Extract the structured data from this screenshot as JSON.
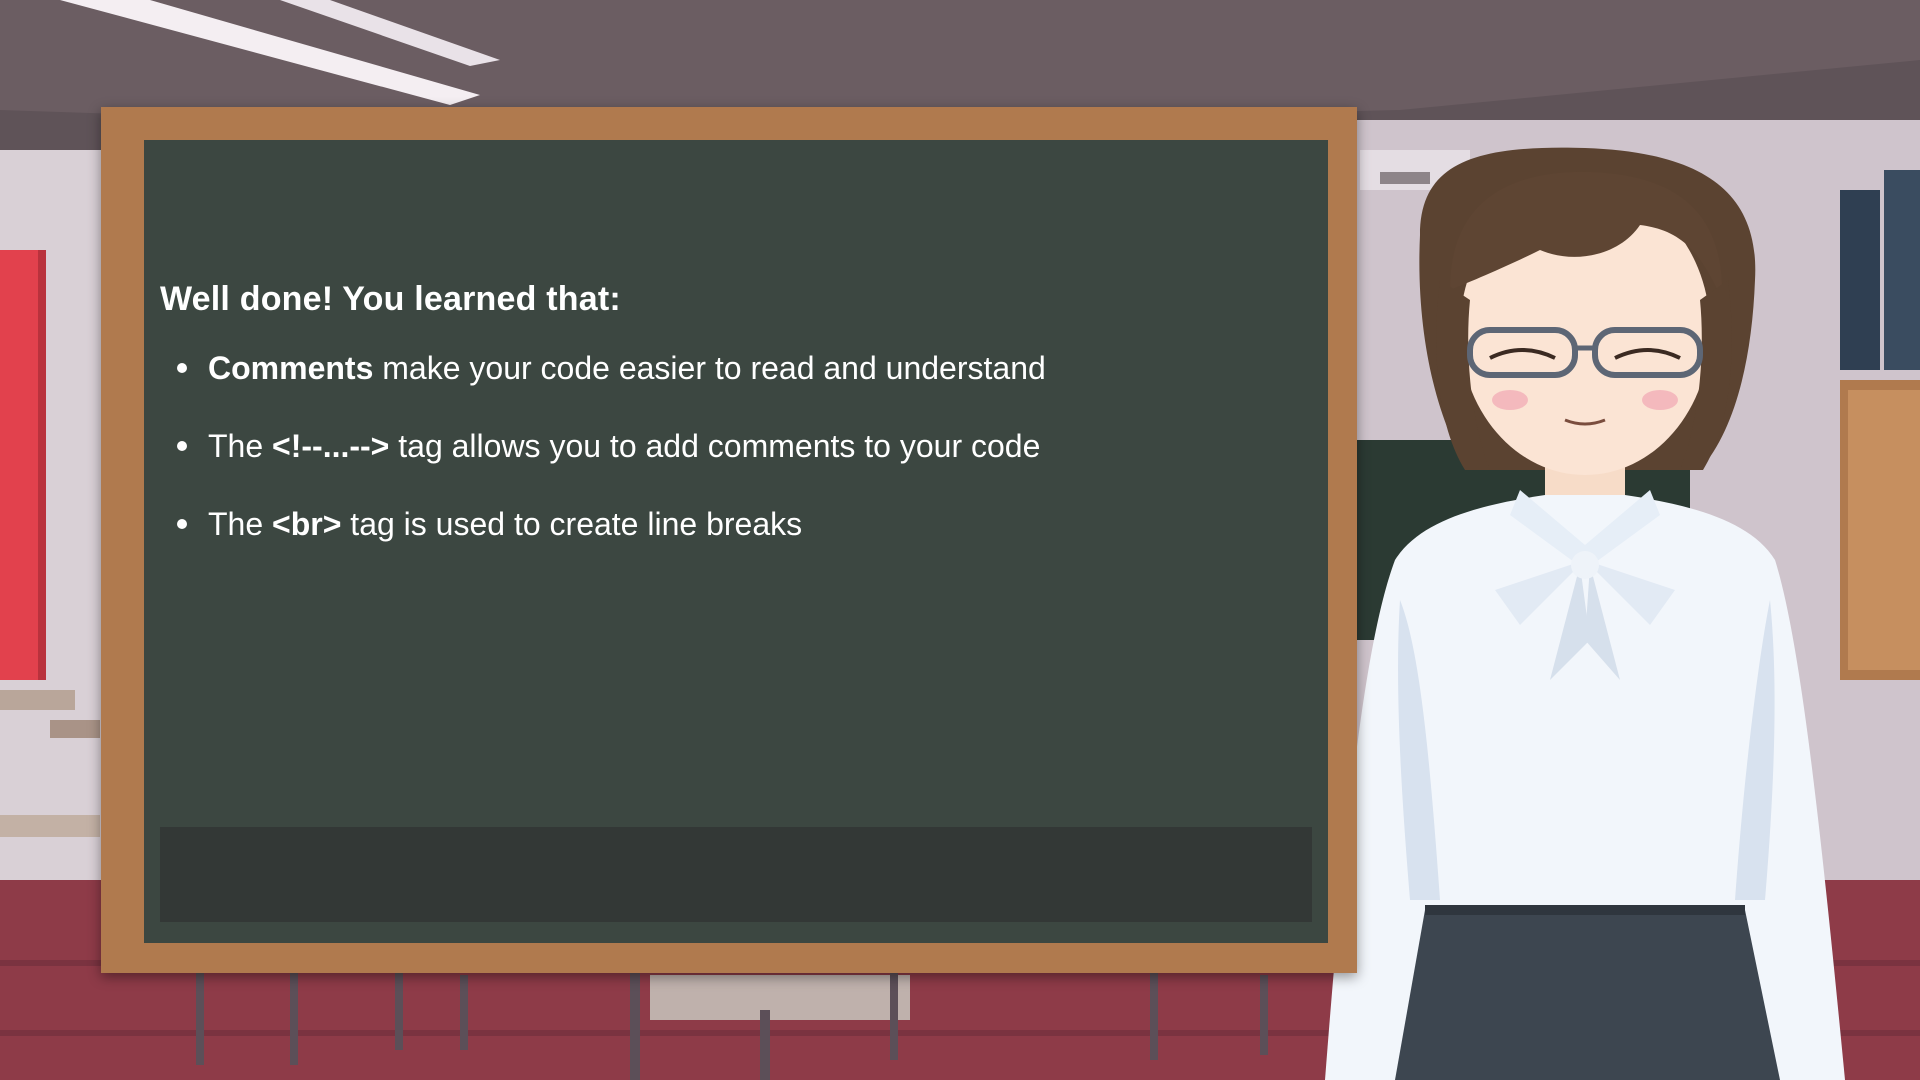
{
  "board": {
    "heading": "Well done! You learned that:",
    "points": [
      {
        "prefix": "",
        "bold": "Comments",
        "suffix": " make your code easier to read and understand"
      },
      {
        "prefix": "The ",
        "bold": "<!--...-->",
        "suffix": " tag allows you to add comments to your code"
      },
      {
        "prefix": "The ",
        "bold": "<br>",
        "suffix": " tag is used to create line breaks"
      }
    ]
  },
  "dialogue": {
    "text": ""
  },
  "colors": {
    "chalkboard": "#3c4741",
    "frame": "#b07a4e",
    "dialogue_box": "#333836",
    "text": "#ffffff"
  }
}
